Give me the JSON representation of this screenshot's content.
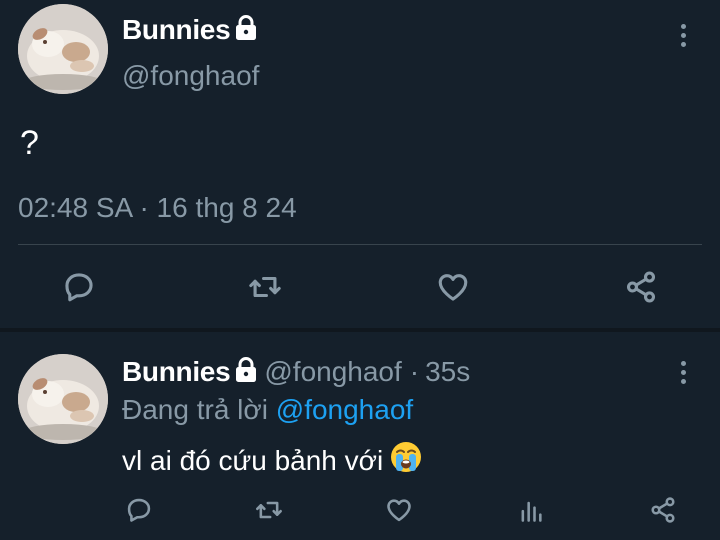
{
  "main_tweet": {
    "display_name": "Bunnies",
    "handle": "@fonghaof",
    "text": "?",
    "time": "02:48 SA",
    "separator": "·",
    "date": "16 thg 8 24"
  },
  "reply": {
    "display_name": "Bunnies",
    "handle": "@fonghaof",
    "separator": "·",
    "age": "35s",
    "replying_prefix": "Đang trả lời",
    "replying_to": "@fonghaof",
    "text": "vl ai đó cứu bảnh với",
    "emoji": "crying-face-emoji"
  },
  "icons": {
    "reply": "comment-icon",
    "retweet": "retweet-icon",
    "like": "heart-icon",
    "share": "share-icon",
    "analytics": "analytics-icon",
    "more": "more-vertical-icon",
    "lock": "lock-icon"
  },
  "colors": {
    "background": "#15202b",
    "text_primary": "#ffffff",
    "text_secondary": "#8899a6",
    "accent": "#1da1f2",
    "divider": "#38444d"
  }
}
